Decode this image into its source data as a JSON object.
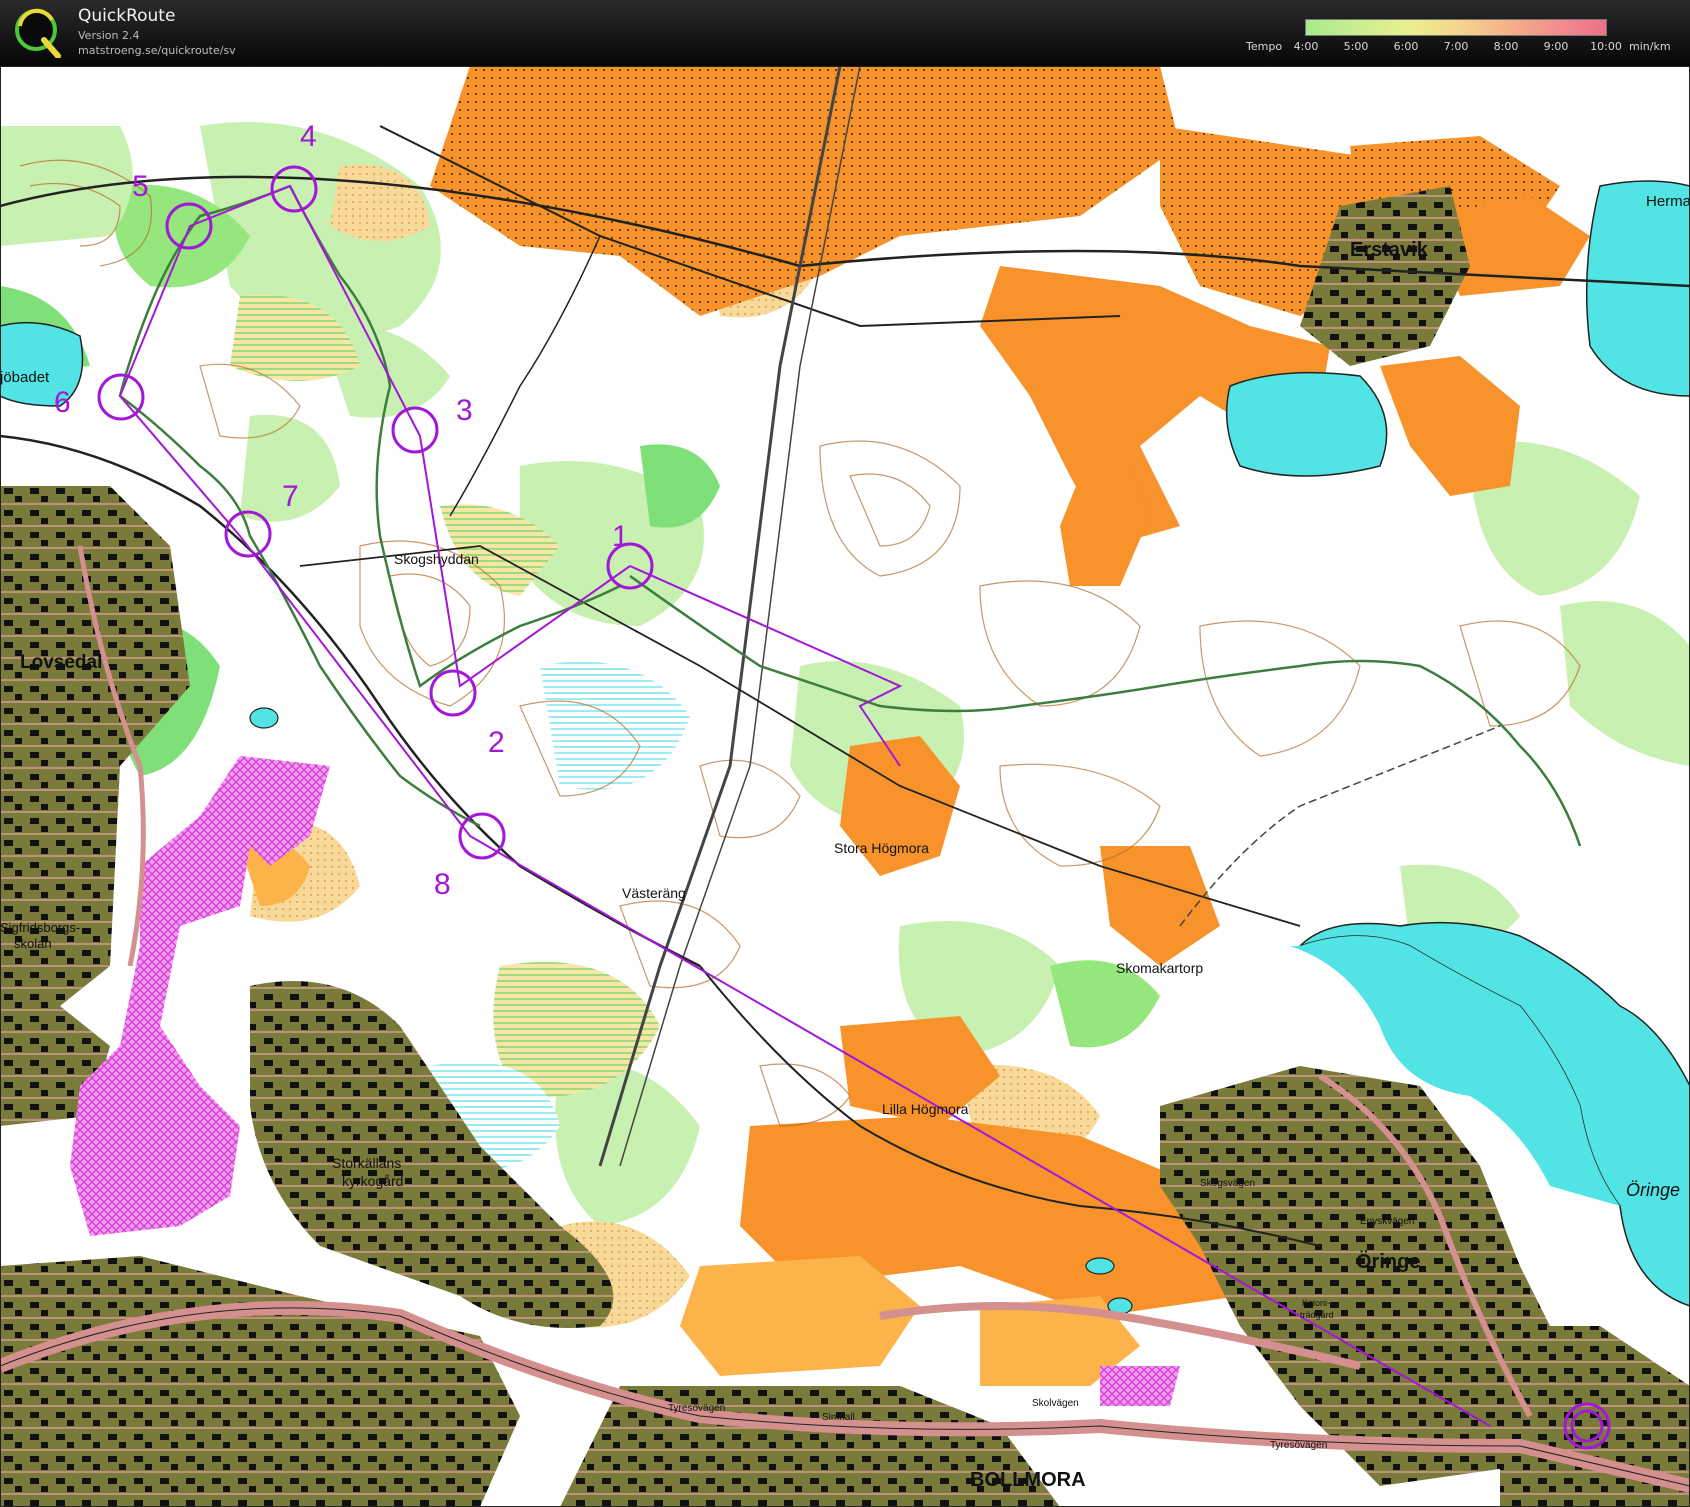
{
  "header": {
    "app_title": "QuickRoute",
    "app_version": "Version 2.4",
    "app_url": "matstroeng.se/quickroute/sv",
    "logo_letter": "Q"
  },
  "tempo_legend": {
    "label": "Tempo",
    "ticks": [
      "4:00",
      "5:00",
      "6:00",
      "7:00",
      "8:00",
      "9:00",
      "10:00"
    ],
    "unit": "min/km",
    "colors": [
      "#a7e98c",
      "#c9ee8f",
      "#e9f08f",
      "#f6d78c",
      "#f4b38a",
      "#f18f8e",
      "#ef6f8a"
    ]
  },
  "map": {
    "colors": {
      "open": "#fbb34a",
      "rough": "#f6dfa0",
      "field": "#f7932a",
      "forest_green": "#7fe07a",
      "light_green": "#c8f0b0",
      "urban": "#7a7a3a",
      "water": "#52e4e4",
      "course": "#a317d8",
      "route": "#3d7d3d",
      "contour": "#b36b2a",
      "road": "#d48f8f",
      "pink": "#e24fe0"
    },
    "labels": [
      {
        "id": "erstavik",
        "text": "Erstavik"
      },
      {
        "id": "herma",
        "text": "Herma"
      },
      {
        "id": "jobadet",
        "text": "jöbadet"
      },
      {
        "id": "skogshyddan",
        "text": "Skogshyddan"
      },
      {
        "id": "lovsedal",
        "text": "Lovsedal"
      },
      {
        "id": "stora-hogmora",
        "text": "Stora Högmora"
      },
      {
        "id": "vasterang",
        "text": "Västeräng"
      },
      {
        "id": "skomakartorp",
        "text": "Skomakartorp"
      },
      {
        "id": "lilla-hogmora",
        "text": "Lilla Högmora"
      },
      {
        "id": "storkallans",
        "text": "Storkällans"
      },
      {
        "id": "kyrkogard",
        "text": "kyrkogård"
      },
      {
        "id": "oringe",
        "text": "Öringe"
      },
      {
        "id": "oringe-lake",
        "text": "Öringe"
      },
      {
        "id": "bollmora",
        "text": "BOLLMORA"
      },
      {
        "id": "sigfridsborgs",
        "text": "Sigfridsborgs-"
      },
      {
        "id": "skolan",
        "text": "skolan"
      },
      {
        "id": "tyresovagen",
        "text": "Tyresövägen"
      },
      {
        "id": "tyresovagen-2",
        "text": "Tyresövägen"
      },
      {
        "id": "skolvagen",
        "text": "Skolvägen"
      },
      {
        "id": "skogsvagen",
        "text": "Skogsvägen"
      },
      {
        "id": "enskavagen",
        "text": "Enyskvägen"
      },
      {
        "id": "simhall",
        "text": "Simhall"
      },
      {
        "id": "koloni",
        "text": "Koloni-"
      },
      {
        "id": "tradgard",
        "text": "trädgård"
      }
    ],
    "controls": [
      {
        "id": "control-1",
        "number": "1"
      },
      {
        "id": "control-2",
        "number": "2"
      },
      {
        "id": "control-3",
        "number": "3"
      },
      {
        "id": "control-4",
        "number": "4"
      },
      {
        "id": "control-5",
        "number": "5"
      },
      {
        "id": "control-6",
        "number": "6"
      },
      {
        "id": "control-7",
        "number": "7"
      },
      {
        "id": "control-8",
        "number": "8"
      }
    ]
  }
}
